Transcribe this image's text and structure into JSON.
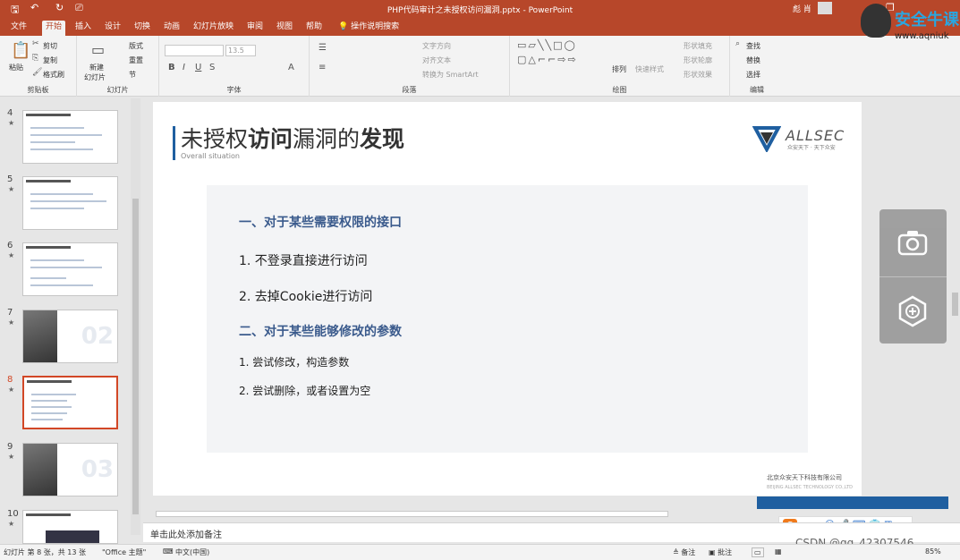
{
  "window": {
    "title": "PHP代码审计之未授权访问漏洞.pptx - PowerPoint",
    "user": "彪 肖"
  },
  "tabs": [
    "文件",
    "开始",
    "插入",
    "设计",
    "切换",
    "动画",
    "幻灯片放映",
    "审阅",
    "视图",
    "帮助",
    "操作说明搜索"
  ],
  "active_tab": "开始",
  "ribbon": {
    "clipboard": {
      "paste": "粘贴",
      "cut": "剪切",
      "copy": "复制",
      "painter": "格式刷",
      "label": "剪贴板"
    },
    "slides": {
      "new": "新建",
      "new2": "幻灯片",
      "layout": "版式",
      "reset": "重置",
      "section": "节",
      "label": "幻灯片"
    },
    "font": {
      "size": "13.5",
      "label": "字体"
    },
    "paragraph": {
      "dir": "文字方向",
      "align": "对齐文本",
      "smartart": "转换为 SmartArt",
      "label": "段落"
    },
    "drawing": {
      "arrange": "排列",
      "styles": "快速样式",
      "fill": "形状填充",
      "outline": "形状轮廓",
      "effect": "形状效果",
      "label": "绘图"
    },
    "editing": {
      "find": "查找",
      "replace": "替换",
      "select": "选择",
      "label": "编辑"
    }
  },
  "thumbnails": [
    {
      "num": "4",
      "star": "★"
    },
    {
      "num": "5",
      "star": "★"
    },
    {
      "num": "6",
      "star": "★"
    },
    {
      "num": "7",
      "star": "★",
      "bigno": "02"
    },
    {
      "num": "8",
      "star": "★",
      "selected": true
    },
    {
      "num": "9",
      "star": "★",
      "bigno": "03"
    },
    {
      "num": "10",
      "star": "★"
    }
  ],
  "slide": {
    "title_prefix": "未授权",
    "title_bold1": "访问",
    "title_mid": "漏洞的",
    "title_bold2": "发现",
    "subtitle": "Overall situation",
    "logo_word": "ALLSEC",
    "logo_tag": "众安天下 · 天下众安",
    "heading1": "一、对于某些需要权限的接口",
    "item1": "1.    不登录直接进行访问",
    "item2": "2.   去掉Cookie进行访问",
    "heading2": "二、对于某些能够修改的参数",
    "item3": "1.   尝试修改，构造参数",
    "item4": "2.   尝试删除，或者设置为空",
    "footer_cn": "北京众安天下科技有限公司",
    "footer_en": "BEIJING ALLSEC TECHNOLOGY CO.,LTD"
  },
  "notes_placeholder": "单击此处添加备注",
  "status": {
    "slide_info": "幻灯片 第 8 张，共 13 张",
    "theme": "\"Office 主题\"",
    "lang": "中文(中国)",
    "notes": "备注",
    "comments": "批注",
    "zoom": "85%"
  },
  "watermark": {
    "brand": "安全牛课",
    "site": "www.aqniuk"
  },
  "ime": {
    "lang": "中"
  },
  "csdn": "CSDN @qq_42307546"
}
